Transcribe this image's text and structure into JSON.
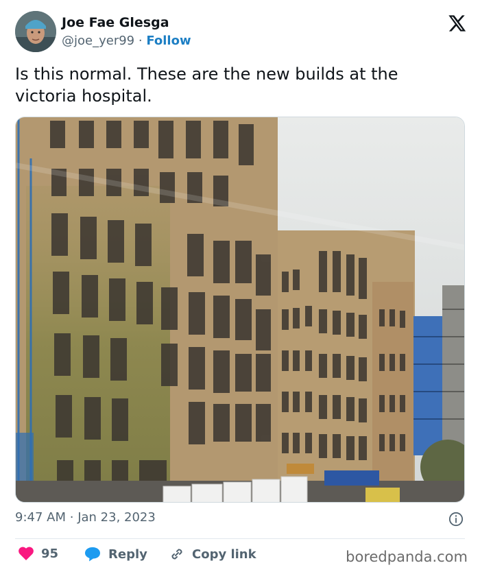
{
  "tweet": {
    "author_name": "Joe Fae Glesga",
    "handle": "@joe_yer99",
    "separator": "·",
    "follow_label": "Follow",
    "text": "Is this normal. These are the new builds at the victoria hospital.",
    "time": "9:47 AM",
    "date": "Jan 23, 2023",
    "likes": "95",
    "reply_label": "Reply",
    "copy_link_label": "Copy link"
  },
  "icons": {
    "platform": "x-logo-icon",
    "info": "info-icon",
    "like": "heart-icon",
    "reply": "speech-bubble-icon",
    "copy": "link-icon"
  },
  "colors": {
    "like_red": "#f91880",
    "link_blue": "#1d9bf0",
    "follow_blue": "#1d7fc4"
  },
  "footer": {
    "watermark": "boredpanda.com"
  }
}
